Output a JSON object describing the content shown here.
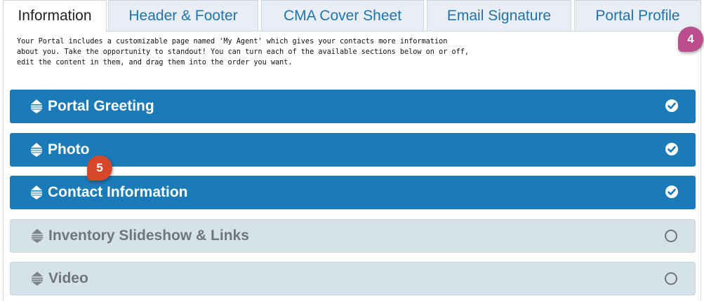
{
  "tabs": [
    {
      "label": "Information",
      "active": true
    },
    {
      "label": "Header & Footer",
      "active": false
    },
    {
      "label": "CMA Cover Sheet",
      "active": false
    },
    {
      "label": "Email Signature",
      "active": false
    },
    {
      "label": "Portal Profile",
      "active": false
    }
  ],
  "intro": {
    "line1": "Your Portal includes a customizable page named 'My Agent' which gives your contacts more information",
    "line2": "about you. Take the opportunity to standout! You can turn each of the available sections below on or off,",
    "line3": "edit the content in them, and drag them into the order you want."
  },
  "sections": [
    {
      "title": "Portal Greeting",
      "enabled": true
    },
    {
      "title": "Photo",
      "enabled": true
    },
    {
      "title": "Contact Information",
      "enabled": true
    },
    {
      "title": "Inventory Slideshow & Links",
      "enabled": false
    },
    {
      "title": "Video",
      "enabled": false
    }
  ],
  "callouts": [
    {
      "label": "4",
      "color": "#b94d8d"
    },
    {
      "label": "5",
      "color": "#d7482b"
    }
  ],
  "icons": {
    "drag": "drag-handle-icon",
    "on": "check-circle-icon",
    "off": "empty-circle-icon"
  },
  "colors": {
    "section_on": "#1b7ab8",
    "section_off": "#d6e2ea",
    "tab_text": "#1e74b0"
  }
}
